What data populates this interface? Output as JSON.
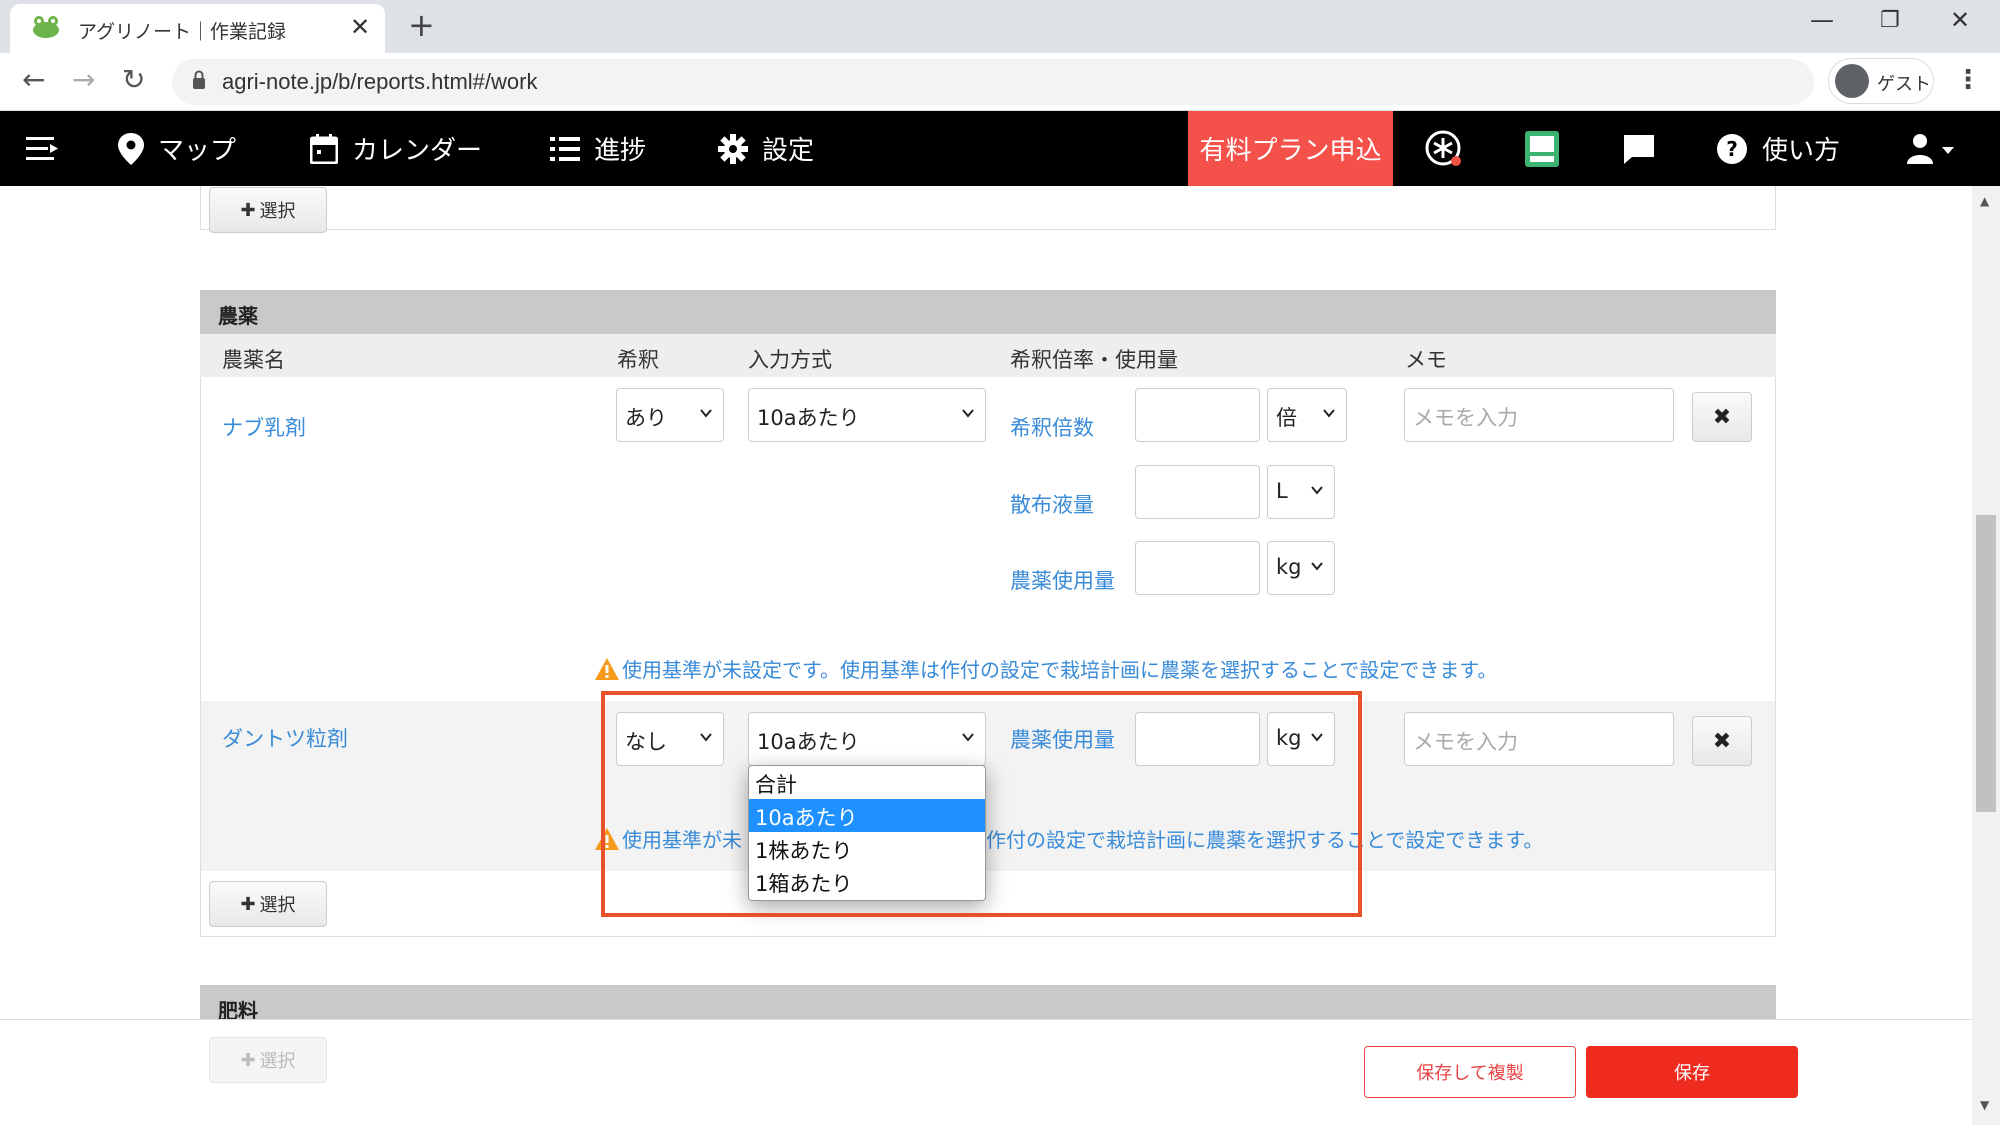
{
  "browser": {
    "tab_title": "アグリノート｜作業記録",
    "tab_close": "✕",
    "new_tab": "+",
    "url": "agri-note.jp/b/reports.html#/work",
    "profile_label": "ゲスト"
  },
  "nav": {
    "map": "マップ",
    "calendar": "カレンダー",
    "progress": "進捗",
    "settings": "設定",
    "paid_plan": "有料プラン申込",
    "help": "使い方"
  },
  "select_button_label": "選択",
  "pesticide_section": {
    "title": "農薬",
    "headers": {
      "name": "農薬名",
      "dilution": "希釈",
      "input_method": "入力方式",
      "rate": "希釈倍率・使用量",
      "memo": "メモ"
    },
    "rows": [
      {
        "name": "ナブ乳剤",
        "dilution": "あり",
        "input_method": "10aあたり",
        "fields": [
          {
            "label": "希釈倍数",
            "unit": "倍"
          },
          {
            "label": "散布液量",
            "unit": "L"
          },
          {
            "label": "農薬使用量",
            "unit": "kg"
          }
        ],
        "memo_placeholder": "メモを入力",
        "warning": "使用基準が未設定です。使用基準は作付の設定で栽培計画に農薬を選択することで設定できます。"
      },
      {
        "name": "ダントツ粒剤",
        "dilution": "なし",
        "input_method": "10aあたり",
        "fields": [
          {
            "label": "農薬使用量",
            "unit": "kg"
          }
        ],
        "memo_placeholder": "メモを入力",
        "warning_left": "使用基準が未",
        "warning_right": "作付の設定で栽培計画に農薬を選択することで設定できます。"
      }
    ],
    "dropdown_options": [
      "合計",
      "10aあたり",
      "1株あたり",
      "1箱あたり"
    ],
    "dropdown_selected_index": 1
  },
  "fertilizer_section": {
    "title": "肥料"
  },
  "footer": {
    "save_and_copy": "保存して複製",
    "save": "保存"
  },
  "colors": {
    "nav_bg": "#000000",
    "plan_bg": "#f4514b",
    "link": "#3a8bd8",
    "save_bg": "#ef2b20",
    "highlight_border": "#e8522a",
    "option_highlight": "#1e90ff"
  }
}
